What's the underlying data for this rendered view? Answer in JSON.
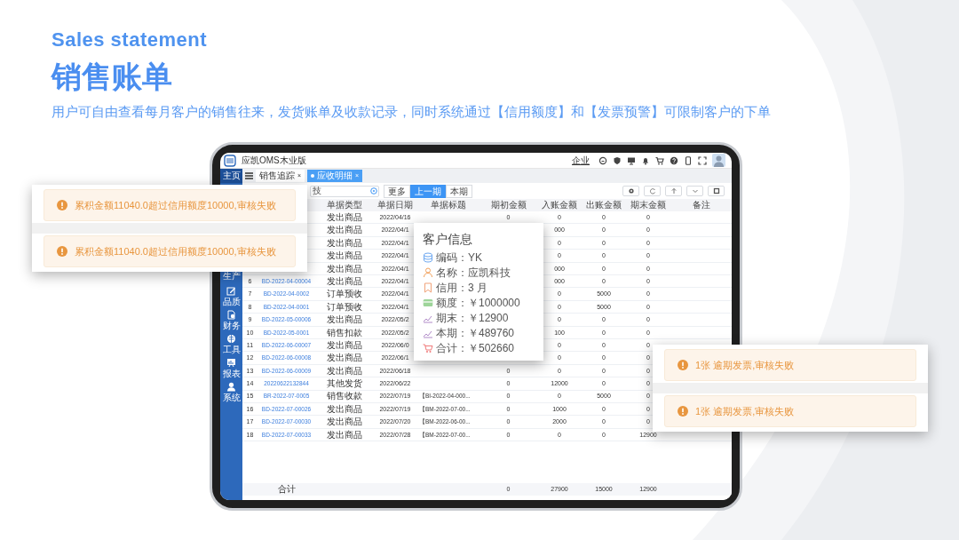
{
  "heading": {
    "english_title": "Sales statement",
    "title": "销售账单",
    "description": "用户可自由查看每月客户的销售往来，发货账单及收款记录，同时系统通过【信用额度】和【发票预警】可限制客户的下单"
  },
  "app": {
    "title": "应凯OMS木业版",
    "top_link": "企业",
    "sidebar": [
      {
        "label": "主页",
        "selected": true
      },
      {
        "label": "生产",
        "selected": false
      },
      {
        "label": "品质",
        "selected": false
      },
      {
        "label": "财务",
        "selected": false
      },
      {
        "label": "工具",
        "selected": false
      },
      {
        "label": "报表",
        "selected": false
      },
      {
        "label": "系统",
        "selected": false
      }
    ],
    "tabs": [
      {
        "label": "销售追踪",
        "close": "×",
        "selected": false
      },
      {
        "label": "应收明细",
        "close": "×",
        "selected": true
      }
    ],
    "search": {
      "value": "技"
    },
    "period_buttons": [
      {
        "label": "更多",
        "selected": false
      },
      {
        "label": "上一期",
        "selected": true
      },
      {
        "label": "本期",
        "selected": false
      }
    ],
    "table": {
      "columns": [
        "单据类型",
        "单据日期",
        "单据标题",
        "期初金额",
        "入账金额",
        "出账金额",
        "期末金额",
        "备注"
      ],
      "rows": [
        {
          "type": "发出商品",
          "date": "2022/04/16",
          "opening": "0",
          "debit": "0",
          "credit": "0",
          "closing": "0"
        },
        {
          "type": "发出商品",
          "date": "2022/04/1",
          "debit": "000",
          "credit": "0",
          "closing": "0"
        },
        {
          "type": "发出商品",
          "date": "2022/04/1",
          "debit": "0",
          "credit": "0",
          "closing": "0"
        },
        {
          "type": "发出商品",
          "date": "2022/04/1",
          "debit": "0",
          "credit": "0",
          "closing": "0"
        },
        {
          "type": "发出商品",
          "date": "2022/04/1",
          "debit": "000",
          "credit": "0",
          "closing": "0"
        },
        {
          "no": "6",
          "code": "BD-2022-04-00004",
          "type": "发出商品",
          "date": "2022/04/1",
          "debit": "000",
          "credit": "0",
          "closing": "0"
        },
        {
          "no": "7",
          "code": "BD-2022-04-0002",
          "type": "订单预收",
          "date": "2022/04/1",
          "debit": "0",
          "credit": "5000",
          "closing": "0"
        },
        {
          "no": "8",
          "code": "BD-2022-04-0001",
          "type": "订单预收",
          "date": "2022/04/1",
          "debit": "0",
          "credit": "5000",
          "closing": "0"
        },
        {
          "no": "9",
          "code": "BD-2022-05-00006",
          "type": "发出商品",
          "date": "2022/05/2",
          "debit": "0",
          "credit": "0",
          "closing": "0"
        },
        {
          "no": "10",
          "code": "BD-2022-05-0001",
          "type": "销售扣款",
          "date": "2022/05/2",
          "debit": "100",
          "credit": "0",
          "closing": "0"
        },
        {
          "no": "11",
          "code": "BD-2022-06-00007",
          "type": "发出商品",
          "date": "2022/06/0",
          "debit": "0",
          "credit": "0",
          "closing": "0"
        },
        {
          "no": "12",
          "code": "BD-2022-06-00008",
          "type": "发出商品",
          "date": "2022/06/1",
          "debit": "0",
          "credit": "0",
          "closing": "0"
        },
        {
          "no": "13",
          "code": "BD-2022-06-00009",
          "type": "发出商品",
          "date": "2022/06/18",
          "opening": "0",
          "debit": "0",
          "credit": "0",
          "closing": "0"
        },
        {
          "no": "14",
          "code": "20220622132844",
          "type": "其他发货",
          "date": "2022/06/22",
          "opening": "0",
          "debit": "12000",
          "credit": "0",
          "closing": "0"
        },
        {
          "no": "15",
          "code": "BR-2022-07-0005",
          "type": "销售收款",
          "date": "2022/07/19",
          "title": "【BI-2022-04-000...",
          "opening": "0",
          "debit": "0",
          "credit": "5000",
          "closing": "0"
        },
        {
          "no": "16",
          "code": "BD-2022-07-00026",
          "type": "发出商品",
          "date": "2022/07/19",
          "title": "【BM-2022-07-00...",
          "opening": "0",
          "debit": "1000",
          "credit": "0",
          "closing": "0"
        },
        {
          "no": "17",
          "code": "BD-2022-07-00030",
          "type": "发出商品",
          "date": "2022/07/20",
          "title": "【BM-2022-06-00...",
          "opening": "0",
          "debit": "2000",
          "credit": "0",
          "closing": "0"
        },
        {
          "no": "18",
          "code": "BD-2022-07-00033",
          "type": "发出商品",
          "date": "2022/07/28",
          "title": "【BM-2022-07-00...",
          "opening": "0",
          "debit": "0",
          "credit": "0",
          "closing": "12900"
        }
      ],
      "totals": {
        "code": "合计",
        "opening": "0",
        "debit": "27900",
        "credit": "15000",
        "closing": "12900"
      }
    }
  },
  "customer_popup": {
    "title": "客户信息",
    "fields": [
      {
        "kind": "code",
        "label": "编码：",
        "value": "YK"
      },
      {
        "kind": "name",
        "label": "名称：",
        "value": "应凯科技"
      },
      {
        "kind": "credit",
        "label": "信用：",
        "value": "3 月"
      },
      {
        "kind": "limit",
        "label": "额度：",
        "value": "￥1000000"
      },
      {
        "kind": "closing",
        "label": "期末：",
        "value": "￥12900"
      },
      {
        "kind": "period",
        "label": "本期：",
        "value": "￥489760"
      },
      {
        "kind": "total",
        "label": "合计：",
        "value": "￥502660"
      }
    ]
  },
  "credit_alerts": [
    {
      "text": "累积金额11040.0超过信用额度10000,审核失败"
    },
    {
      "text": "累积金额11040.0超过信用额度10000,审核失败"
    }
  ],
  "invoice_alerts": [
    {
      "text": "1张 逾期发票,审核失败"
    },
    {
      "text": "1张 逾期发票,审核失败"
    }
  ]
}
